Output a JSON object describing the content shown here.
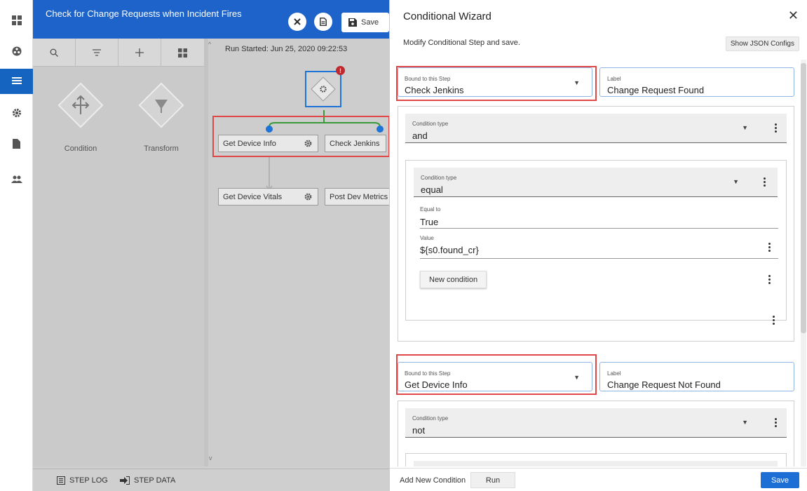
{
  "workflow": {
    "title": "Check for Change Requests when Incident Fires",
    "save_label": "Save"
  },
  "palette": {
    "items": [
      {
        "label": "Condition"
      },
      {
        "label": "Transform"
      }
    ]
  },
  "canvas": {
    "run_started": "Run Started: Jun 25, 2020 09:22:53",
    "nodes": {
      "get_device_info": "Get Device Info",
      "check_jenkins": "Check Jenkins",
      "get_device_vitals": "Get Device Vitals",
      "post_dev_metrics": "Post Dev Metrics t"
    }
  },
  "bottom": {
    "step_log": "STEP LOG",
    "step_data": "STEP DATA"
  },
  "wizard": {
    "title": "Conditional Wizard",
    "close": "✕",
    "subtitle": "Modify Conditional Step and save.",
    "show_json": "Show JSON Configs",
    "block1": {
      "bound_label": "Bound to this Step",
      "bound_value": "Check Jenkins",
      "label_label": "Label",
      "label_value": "Change Request Found",
      "cond_type_label": "Condition type",
      "cond_type_value": "and",
      "inner": {
        "cond_type_label": "Condition type",
        "cond_type_value": "equal",
        "equal_label": "Equal to",
        "equal_value": "True",
        "value_label": "Value",
        "value_value": "${s0.found_cr}",
        "new_condition": "New condition"
      }
    },
    "block2": {
      "bound_label": "Bound to this Step",
      "bound_value": "Get Device Info",
      "label_label": "Label",
      "label_value": "Change Request Not Found",
      "cond_type_label": "Condition type",
      "cond_type_value": "not"
    },
    "footer": {
      "add_new_condition": "Add New Condition",
      "run": "Run",
      "save": "Save"
    }
  },
  "colors": {
    "accent": "#1d63c9",
    "highlight": "#e04848",
    "node_dot": "#1e73d6",
    "branch_line": "#3a9a3a"
  }
}
